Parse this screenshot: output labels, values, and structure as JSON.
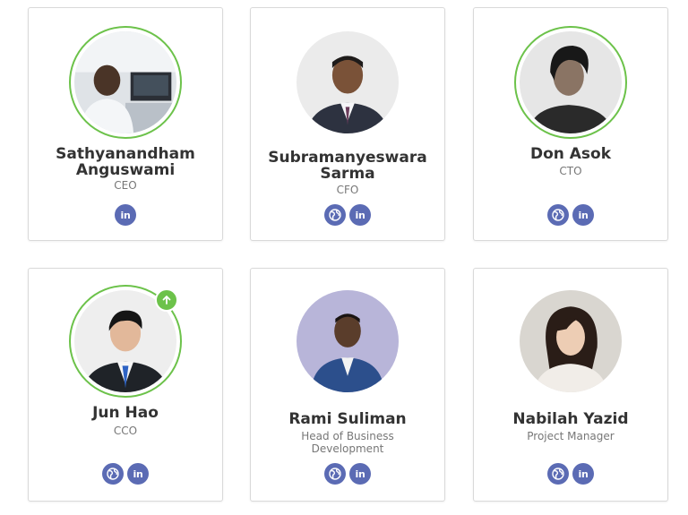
{
  "team": [
    {
      "first": "Sathyanandham",
      "last": "Anguswami",
      "role": "CEO",
      "links": [
        "linkedin"
      ],
      "highlight": true,
      "badge": false
    },
    {
      "first": "Subramanyeswara",
      "last": "Sarma",
      "role": "CFO",
      "links": [
        "website",
        "linkedin"
      ],
      "highlight": false,
      "badge": false
    },
    {
      "first": "Don Asok",
      "last": "",
      "role": "CTO",
      "links": [
        "website",
        "linkedin"
      ],
      "highlight": true,
      "badge": false
    },
    {
      "first": "Jun Hao",
      "last": "",
      "role": "CCO",
      "links": [
        "website",
        "linkedin"
      ],
      "highlight": true,
      "badge": true
    },
    {
      "first": "Rami Suliman",
      "last": "",
      "role_line1": "Head of Business",
      "role_line2": "Development",
      "links": [
        "website",
        "linkedin"
      ],
      "highlight": false,
      "badge": false
    },
    {
      "first": "Nabilah Yazid",
      "last": "",
      "role": "Project Manager",
      "links": [
        "website",
        "linkedin"
      ],
      "highlight": false,
      "badge": false
    }
  ],
  "icons": {
    "linkedin": "linkedin-icon",
    "website": "globe-icon",
    "badge": "arrow-up-icon"
  },
  "colors": {
    "ring": "#6cc24a",
    "social": "#5b6bb4",
    "name": "#333333",
    "role": "#777777"
  },
  "linkedin_text": "in"
}
